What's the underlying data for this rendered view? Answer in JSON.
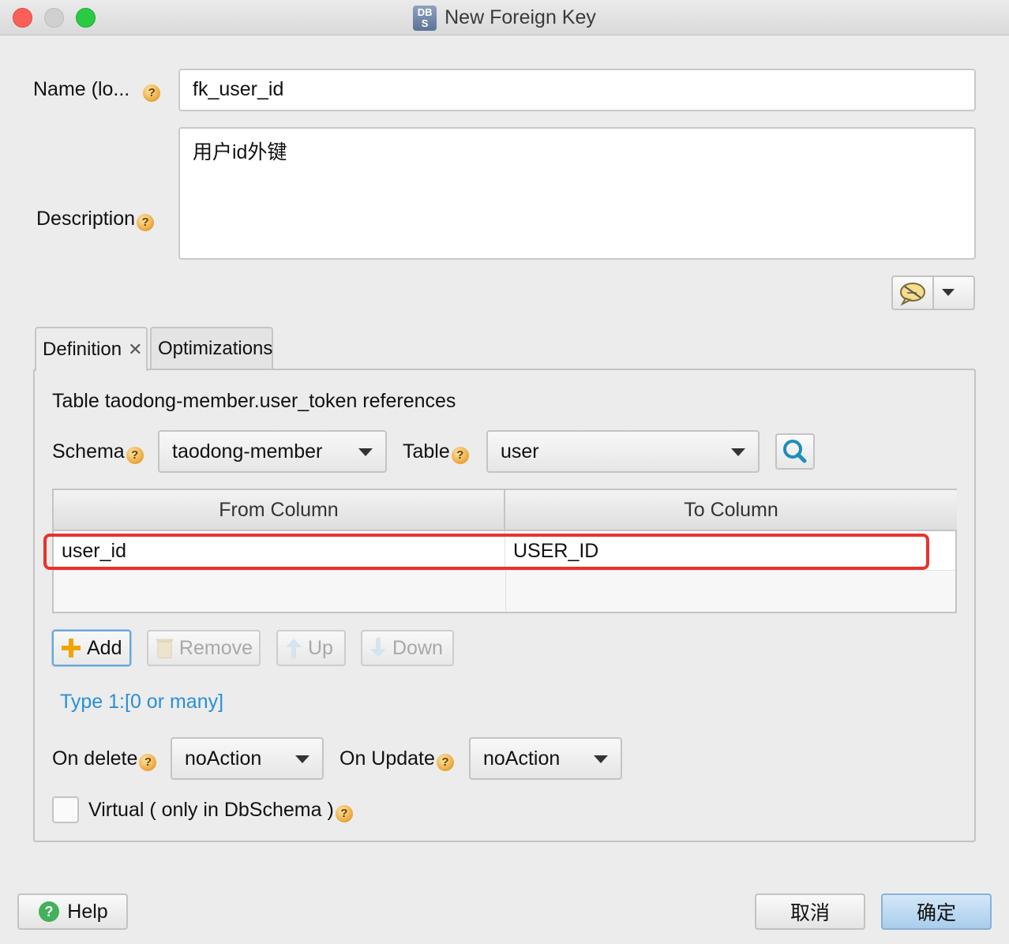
{
  "window": {
    "title": "New Foreign Key",
    "app_icon_text": "DB S"
  },
  "form": {
    "name_label": "Name (lo...",
    "name_value": "fk_user_id",
    "description_label": "Description",
    "description_value": "用户id外键",
    "help_glyph": "?"
  },
  "tabs": [
    {
      "label": "Definition",
      "active": true,
      "close_glyph": "✕"
    },
    {
      "label": "Optimizations",
      "active": false
    }
  ],
  "definition": {
    "heading": "Table taodong-member.user_token references",
    "schema_label": "Schema",
    "schema_value": "taodong-member",
    "table_label": "Table",
    "table_value": "user",
    "columns_table": {
      "headers": [
        "From Column",
        "To Column"
      ],
      "rows": [
        {
          "from": "user_id",
          "to": "USER_ID"
        }
      ]
    },
    "buttons": {
      "add": "Add",
      "remove": "Remove",
      "up": "Up",
      "down": "Down"
    },
    "type_link": "Type 1:[0 or many]",
    "on_delete_label": "On delete",
    "on_delete_value": "noAction",
    "on_update_label": "On Update",
    "on_update_value": "noAction",
    "virtual_label": "Virtual ( only in DbSchema )",
    "virtual_checked": false
  },
  "footer": {
    "help": "Help",
    "cancel": "取消",
    "ok": "确定"
  },
  "colors": {
    "accent": "#2a8fd6",
    "highlight": "#e8322d",
    "primary_button": "#a9cdec"
  },
  "icons": {
    "comment_button": "speech-bubble-icon",
    "search_button": "search-icon",
    "add": "plus-icon",
    "remove": "trash-icon",
    "up": "arrow-up-icon",
    "down": "arrow-down-icon",
    "help": "question-circle-icon"
  }
}
